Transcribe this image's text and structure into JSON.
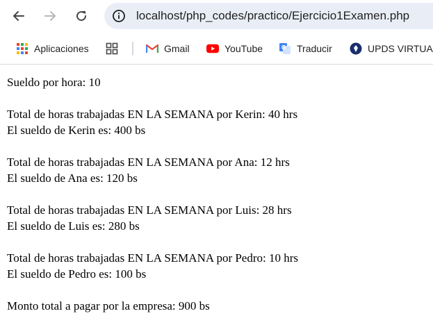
{
  "browser": {
    "url": "localhost/php_codes/practico/Ejercicio1Examen.php",
    "bookmarks": [
      {
        "label": "Aplicaciones",
        "icon": "apps-grid-icon"
      },
      {
        "label": "",
        "icon": "grid-icon"
      },
      {
        "label": "Gmail",
        "icon": "gmail-icon"
      },
      {
        "label": "YouTube",
        "icon": "youtube-icon"
      },
      {
        "label": "Traducir",
        "icon": "translate-icon"
      },
      {
        "label": "UPDS VIRTUAL",
        "icon": "upds-icon"
      }
    ]
  },
  "page": {
    "rate": "Sueldo por hora: 10",
    "employees": [
      {
        "hours": "Total de horas trabajadas EN LA SEMANA por Kerin: 40 hrs",
        "salary": "El sueldo de Kerin es: 400 bs"
      },
      {
        "hours": "Total de horas trabajadas EN LA SEMANA por Ana: 12 hrs",
        "salary": "El sueldo de Ana es: 120 bs"
      },
      {
        "hours": "Total de horas trabajadas EN LA SEMANA por Luis: 28 hrs",
        "salary": "El sueldo de Luis es: 280 bs"
      },
      {
        "hours": "Total de horas trabajadas EN LA SEMANA por Pedro: 10 hrs",
        "salary": "El sueldo de Pedro es: 100 bs"
      }
    ],
    "total": "Monto total a pagar por la empresa: 900 bs"
  }
}
